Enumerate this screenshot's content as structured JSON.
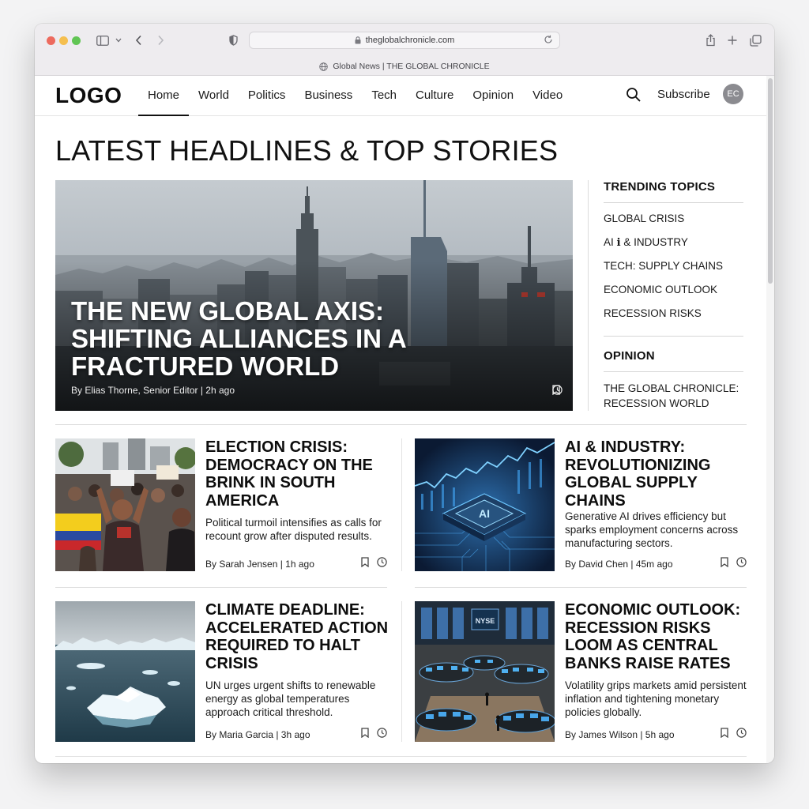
{
  "browser": {
    "url": "theglobalchronicle.com",
    "tab_title": "Global News | THE GLOBAL CHRONICLE"
  },
  "site": {
    "logo": "LOGO",
    "nav": [
      "Home",
      "World",
      "Politics",
      "Business",
      "Tech",
      "Culture",
      "Opinion",
      "Video"
    ],
    "active_nav": "Home",
    "subscribe": "Subscribe",
    "avatar_initials": "EC"
  },
  "page_title": "LATEST HEADLINES & TOP STORIES",
  "hero": {
    "title": "THE NEW GLOBAL AXIS: SHIFTING ALLIANCES IN A FRACTURED WORLD",
    "byline": "By Elias Thorne, Senior Editor | 2h ago"
  },
  "sidebar": {
    "trending_heading": "TRENDING TOPICS",
    "trending": [
      "GLOBAL CRISIS",
      "AI ℹ︎ & INDUSTRY",
      "TECH: SUPPLY CHAINS",
      "ECONOMIC OUTLOOK",
      "RECESSION RISKS"
    ],
    "opinion_heading": "OPINION",
    "opinion_item": "THE GLOBAL CHRONICLE: RECESSION WORLD"
  },
  "cards": [
    {
      "title": "ELECTION CRISIS: DEMOCRACY ON THE BRINK IN SOUTH AMERICA",
      "desc": "Political turmoil intensifies as calls for recount grow after disputed results.",
      "byline": "By Sarah Jensen | 1h ago"
    },
    {
      "title": "AI & INDUSTRY: REVOLUTIONIZING GLOBAL SUPPLY CHAINS",
      "desc": "Generative AI drives efficiency but sparks employment concerns across manufacturing sectors.",
      "byline": "By David Chen | 45m ago",
      "chip_label": "AI"
    },
    {
      "title": "CLIMATE DEADLINE: ACCELERATED ACTION REQUIRED TO HALT CRISIS",
      "desc": "UN urges urgent shifts to renewable energy as global temperatures approach critical threshold.",
      "byline": "By Maria Garcia | 3h ago"
    },
    {
      "title": "ECONOMIC OUTLOOK: RECESSION RISKS LOOM AS CENTRAL BANKS RAISE RATES",
      "desc": "Volatility grips markets amid persistent inflation and tightening monetary policies globally.",
      "byline": "By James Wilson | 5h ago",
      "sign_label": "NYSE"
    }
  ],
  "icons": {
    "bookmark": "bookmark-icon",
    "clock": "clock-icon",
    "search": "search-icon",
    "shield": "shield-icon",
    "share": "share-icon",
    "new_tab": "plus-icon",
    "tabs": "tabs-overview-icon",
    "sidebar": "sidebar-icon",
    "globe": "globe-icon"
  }
}
